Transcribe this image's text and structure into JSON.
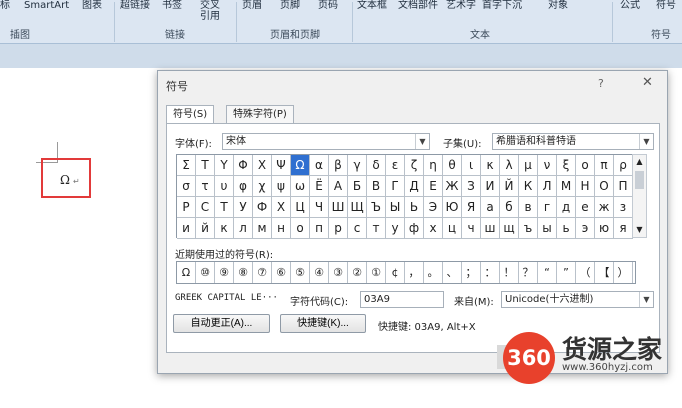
{
  "ribbon": {
    "top_items": [
      "标",
      "SmartArt",
      "图表",
      "超链接",
      "书签",
      "交叉\n引用",
      "页眉",
      "页脚",
      "页码",
      "文本框",
      "文档部件",
      "艺术字",
      "首字下沉",
      "对象",
      "公式",
      "符号"
    ],
    "groups": [
      "插图",
      "链接",
      "页眉和页脚",
      "文本",
      "符号"
    ]
  },
  "document": {
    "inserted_char": "Ω",
    "para_mark": "↵"
  },
  "dialog": {
    "title": "符号",
    "help": "?",
    "close": "✕",
    "tabs": [
      "符号(S)",
      "特殊字符(P)"
    ],
    "font_label": "字体(F):",
    "font_value": "宋体",
    "subset_label": "子集(U):",
    "subset_value": "希腊语和科普特语",
    "grid_rows": [
      [
        "Σ",
        "Τ",
        "Υ",
        "Φ",
        "Χ",
        "Ψ",
        "Ω",
        "α",
        "β",
        "γ",
        "δ",
        "ε",
        "ζ",
        "η",
        "θ",
        "ι",
        "κ",
        "λ",
        "μ",
        "ν",
        "ξ",
        "ο",
        "π",
        "ρ"
      ],
      [
        "σ",
        "τ",
        "υ",
        "φ",
        "χ",
        "ψ",
        "ω",
        "Ё",
        "А",
        "Б",
        "В",
        "Г",
        "Д",
        "Е",
        "Ж",
        "З",
        "И",
        "Й",
        "К",
        "Л",
        "М",
        "Н",
        "О",
        "П"
      ],
      [
        "Р",
        "С",
        "Т",
        "У",
        "Ф",
        "Х",
        "Ц",
        "Ч",
        "Ш",
        "Щ",
        "Ъ",
        "Ы",
        "Ь",
        "Э",
        "Ю",
        "Я",
        "а",
        "б",
        "в",
        "г",
        "д",
        "е",
        "ж",
        "з"
      ],
      [
        "и",
        "й",
        "к",
        "л",
        "м",
        "н",
        "о",
        "п",
        "р",
        "с",
        "т",
        "у",
        "ф",
        "х",
        "ц",
        "ч",
        "ш",
        "щ",
        "ъ",
        "ы",
        "ь",
        "э",
        "ю",
        "я"
      ]
    ],
    "selected_row": 0,
    "selected_col": 6,
    "recent_label": "近期使用过的符号(R):",
    "recent": [
      "Ω",
      "⑩",
      "⑨",
      "⑧",
      "⑦",
      "⑥",
      "⑤",
      "④",
      "③",
      "②",
      "①",
      "¢",
      "，",
      "。",
      "、",
      "；",
      "：",
      "！",
      "？",
      "“",
      "”",
      "（",
      "【",
      "）"
    ],
    "char_name": "GREEK CAPITAL LE···",
    "code_label": "字符代码(C):",
    "code_value": "03A9",
    "from_label": "来自(M):",
    "from_value": "Unicode(十六进制)",
    "autocorrect_btn": "自动更正(A)...",
    "shortcut_btn": "快捷键(K)...",
    "shortcut_text": "快捷键: 03A9, Alt+X"
  },
  "watermark": {
    "badge": "360",
    "title": "货源之家",
    "url": "www.360hyzj.com",
    "badge_color": "#e8412c"
  }
}
